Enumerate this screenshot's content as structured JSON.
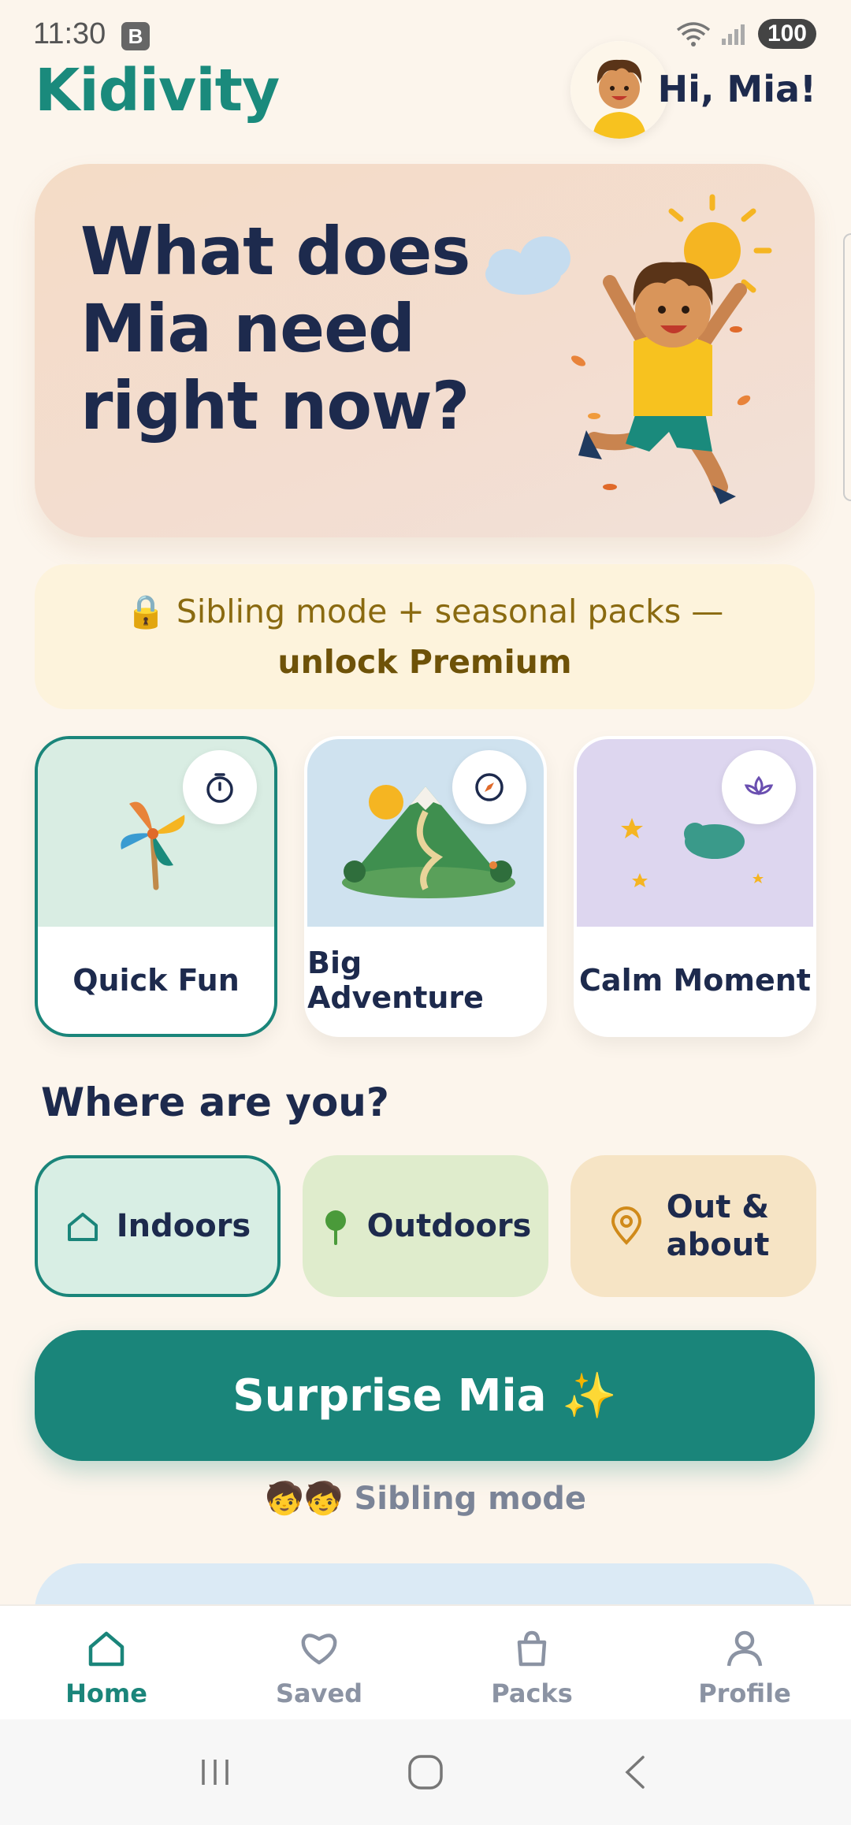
{
  "status": {
    "time": "11:30",
    "b_badge": "B",
    "battery": "100",
    "wifi_label": "5"
  },
  "header": {
    "logo": "Kidivity",
    "greeting": "Hi, Mia!"
  },
  "hero": {
    "title": "What does Mia need right now?"
  },
  "premium": {
    "icon": "🔒",
    "text": "Sibling mode + seasonal packs — ",
    "cta": "unlock Premium"
  },
  "moods": [
    {
      "label": "Quick Fun",
      "icon": "stopwatch-icon",
      "bg": "#d9ede3",
      "active": true
    },
    {
      "label": "Big Adventure",
      "icon": "compass-icon",
      "bg": "#cfe2ef",
      "active": false
    },
    {
      "label": "Calm Moment",
      "icon": "lotus-icon",
      "bg": "#ddd6ef",
      "active": false
    }
  ],
  "where": {
    "title": "Where are you?",
    "options": [
      {
        "label": "Indoors",
        "icon": "home-icon",
        "bg": "#d8eee4",
        "active": true
      },
      {
        "label": "Outdoors",
        "icon": "tree-icon",
        "bg": "#dfeccc",
        "active": false
      },
      {
        "label": "Out & about",
        "icon": "map-pin-icon",
        "bg": "#f6e4c5",
        "active": false
      }
    ]
  },
  "surprise": {
    "label": "Surprise Mia ✨"
  },
  "sibling": {
    "emoji": "🧒🧒",
    "label": "Sibling mode"
  },
  "nav": [
    {
      "label": "Home",
      "icon": "home-icon",
      "active": true
    },
    {
      "label": "Saved",
      "icon": "heart-icon",
      "active": false
    },
    {
      "label": "Packs",
      "icon": "shopping-bag-icon",
      "active": false
    },
    {
      "label": "Profile",
      "icon": "person-icon",
      "active": false
    }
  ],
  "colors": {
    "accent": "#1a857a",
    "navy": "#1d2a4d",
    "background": "#fcf5ec"
  }
}
